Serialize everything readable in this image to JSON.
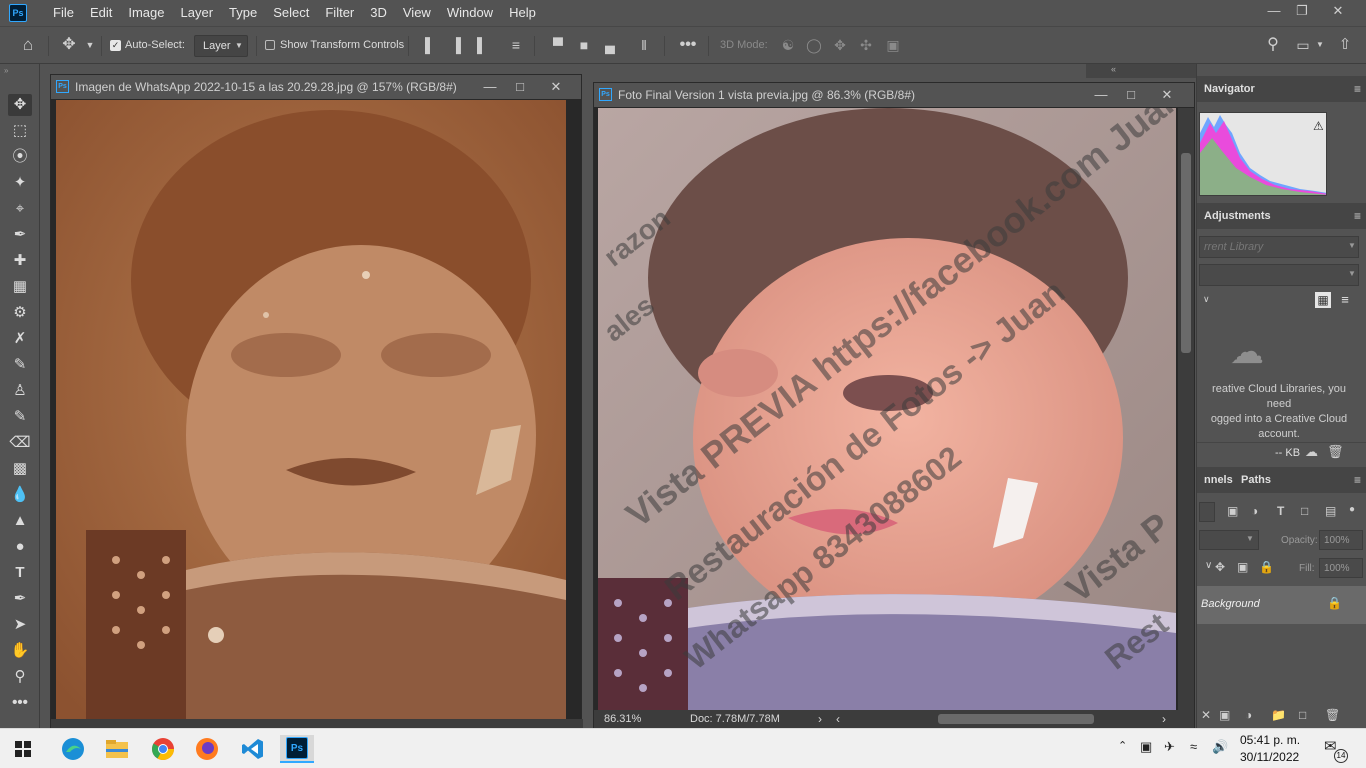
{
  "menubar": {
    "items": [
      "File",
      "Edit",
      "Image",
      "Layer",
      "Type",
      "Select",
      "Filter",
      "3D",
      "View",
      "Window",
      "Help"
    ]
  },
  "options": {
    "auto_select_label": "Auto-Select:",
    "auto_select_value": "Layer",
    "transform_label": "Show Transform Controls",
    "mode3d_label": "3D Mode:"
  },
  "doc1": {
    "title": "Imagen de WhatsApp 2022-10-15 a las 20.29.28.jpg @ 157% (RGB/8#)"
  },
  "doc2": {
    "title": "Foto Final Version 1 vista previa.jpg @ 86.3% (RGB/8#)",
    "zoom": "86.31%",
    "doc_size": "Doc: 7.78M/7.78M"
  },
  "watermark": {
    "line1": "Vista PREVIA https://facebook.com Juan",
    "line2": "Restauración de Fotos -> Juan",
    "line3": "Whatsapp 8343088602",
    "line4": "Vista P",
    "line5": "Rest",
    "line6": "razon",
    "line7": "ales"
  },
  "panels": {
    "navigator": "Navigator",
    "adjustments": "Adjustments",
    "library_placeholder": "rrent Library",
    "cc_message": "reative Cloud Libraries, you need\nogged into a Creative Cloud\naccount.",
    "kb": "-- KB",
    "channels_tab": "nnels",
    "paths_tab": "Paths",
    "opacity_label": "Opacity:",
    "opacity_value": "100%",
    "fill_label": "Fill:",
    "fill_value": "100%",
    "layer_name": "Background"
  },
  "taskbar": {
    "time": "05:41 p. m.",
    "date": "30/11/2022",
    "notif_count": "14"
  },
  "colors": {
    "ps_blue": "#31a8ff",
    "ui_gray": "#535353",
    "dark_gray": "#282828"
  }
}
